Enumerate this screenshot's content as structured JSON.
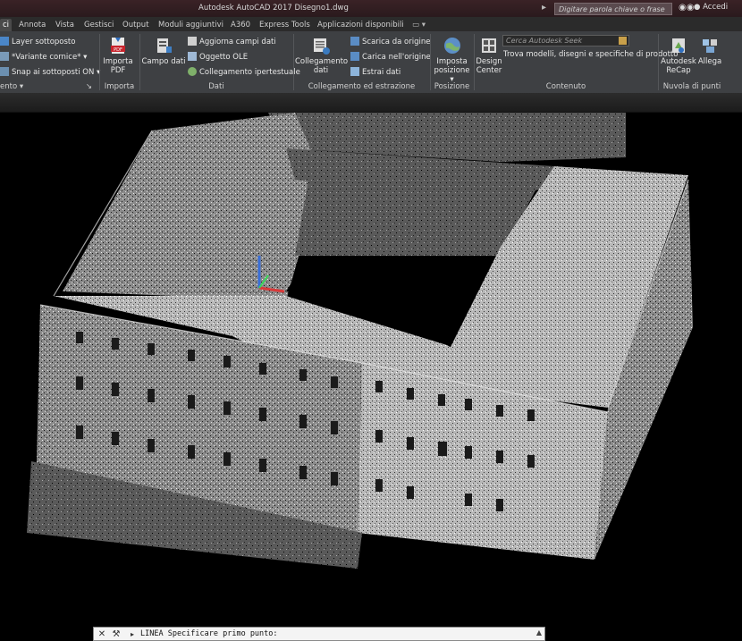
{
  "window": {
    "title": "Autodesk AutoCAD 2017    Disegno1.dwg"
  },
  "search": {
    "placeholder": "Digitare parola chiave o frase"
  },
  "user": {
    "label": "Accedi"
  },
  "tabs": [
    {
      "label": "ci",
      "active": true
    },
    {
      "label": "Annota"
    },
    {
      "label": "Vista"
    },
    {
      "label": "Gestisci"
    },
    {
      "label": "Output"
    },
    {
      "label": "Moduli aggiuntivi"
    },
    {
      "label": "A360"
    },
    {
      "label": "Express Tools"
    },
    {
      "label": "Applicazioni disponibili"
    }
  ],
  "ribbon": {
    "riferimento": {
      "layer_sottoposto": "Layer sottoposto",
      "variante": "*Variante cornice*",
      "snap": "Snap ai sottoposti ON",
      "title": "ento"
    },
    "importa": {
      "importa_pdf": "Importa PDF",
      "title": "Importa"
    },
    "dati": {
      "campo_dati": "Campo dati",
      "aggiorna": "Aggiorna campi dati",
      "oggetto_ole": "Oggetto OLE",
      "collegamento_iper": "Collegamento ipertestuale",
      "title": "Dati"
    },
    "collegamento": {
      "collegamento_dati": "Collegamento dati",
      "scarica": "Scarica da origine",
      "carica": "Carica nell'origine",
      "estrai": "Estrai  dati",
      "title": "Collegamento ed estrazione"
    },
    "posizione": {
      "imposta": "Imposta posizione",
      "title": "Posizione"
    },
    "contenuto": {
      "design_center": "Design Center",
      "seek_placeholder": "Cerca Autodesk Seek",
      "trova": "Trova modelli, disegni e specifiche di prodotto",
      "title": "Contenuto"
    },
    "nuvola": {
      "recap": "Autodesk ReCap",
      "allega": "Allega",
      "title": "Nuvola di punti"
    }
  },
  "command": {
    "prompt": "LINEA Specificare primo punto:"
  },
  "colors": {
    "ribbon_bg": "#3e4043",
    "titlebar_bg": "#2a1a1d",
    "viewport_bg": "#000000"
  }
}
